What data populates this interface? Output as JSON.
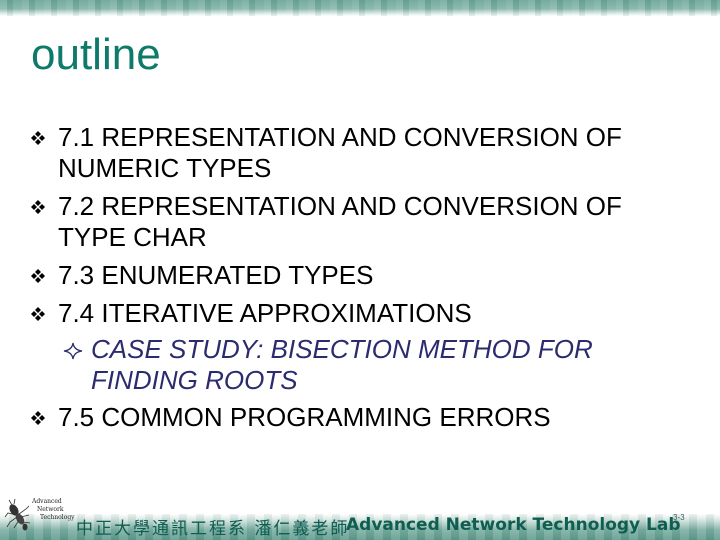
{
  "slide": {
    "title": "outline",
    "colors": {
      "title": "#0e7a6a",
      "body_text": "#000000",
      "sub_text": "#2b2b6e",
      "band": "#6fa79a",
      "footer_text": "#0e5e52"
    },
    "items": [
      {
        "level": 1,
        "icon": "diamond-cluster-bullet",
        "lines": [
          "7.1 REPRESENTATION AND CONVERSION OF",
          "NUMERIC TYPES"
        ]
      },
      {
        "level": 1,
        "icon": "diamond-cluster-bullet",
        "lines": [
          "7.2 REPRESENTATION AND CONVERSION OF",
          "TYPE CHAR"
        ]
      },
      {
        "level": 1,
        "icon": "diamond-cluster-bullet",
        "lines": [
          "7.3 ENUMERATED TYPES"
        ]
      },
      {
        "level": 1,
        "icon": "diamond-cluster-bullet",
        "lines": [
          "7.4 ITERATIVE APPROXIMATIONS"
        ]
      },
      {
        "level": 2,
        "icon": "four-point-star-bullet",
        "lines": [
          "CASE STUDY: BISECTION METHOD FOR",
          "FINDING ROOTS"
        ]
      },
      {
        "level": 1,
        "icon": "diamond-cluster-bullet",
        "lines": [
          "7.5 COMMON PROGRAMMING ERRORS"
        ]
      }
    ]
  },
  "footer": {
    "logo_lines": [
      "Advanced",
      "Network",
      "Technology"
    ],
    "institution_cn": "中正大學通訊工程系 潘仁義老師",
    "lab_name": "Advanced Network Technology Lab",
    "page_number": "3-3"
  }
}
